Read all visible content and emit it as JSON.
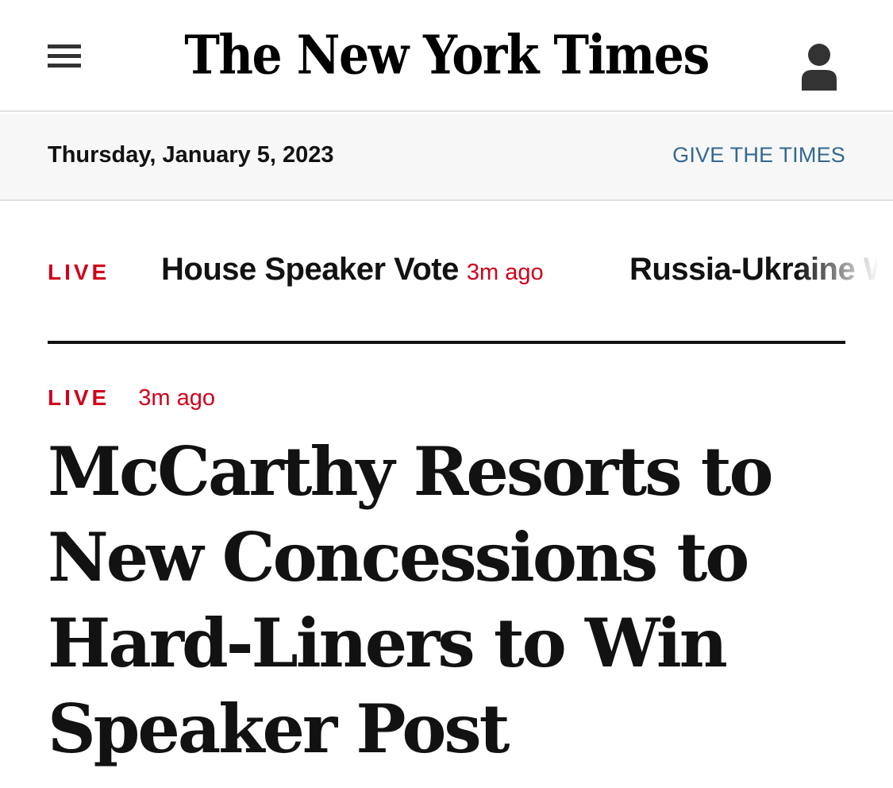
{
  "masthead": {
    "logo_text": "The New York Times",
    "menu_icon": "hamburger-menu-icon",
    "account_icon": "user-account-icon"
  },
  "datebar": {
    "date": "Thursday, January 5, 2023",
    "give_link": "GIVE THE TIMES"
  },
  "ticker": {
    "live_label": "LIVE",
    "items": [
      {
        "label": "House Speaker Vote",
        "time": "3m ago"
      },
      {
        "label": "Russia-Ukraine War",
        "time": ""
      }
    ]
  },
  "story": {
    "live_label": "LIVE",
    "time": "3m ago",
    "headline": "McCarthy Resorts to New Concessions to Hard-Liners to Win Speaker Post"
  },
  "colors": {
    "live_red": "#d0021b",
    "link_blue": "#326891",
    "text": "#121212",
    "datebar_bg": "#f7f7f7"
  }
}
